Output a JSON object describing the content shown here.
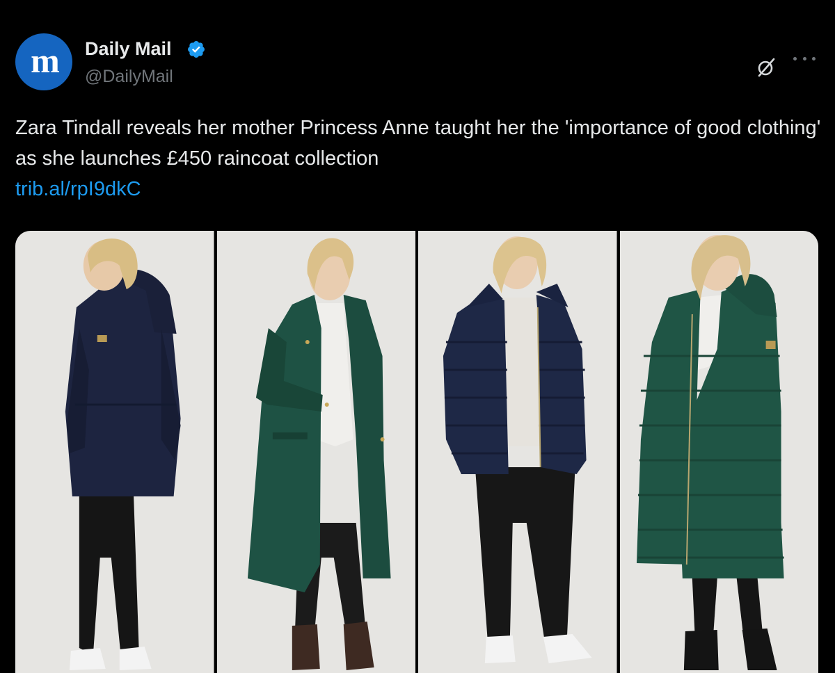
{
  "author": {
    "name": "Daily Mail",
    "handle": "@DailyMail",
    "avatar_letter": "m",
    "verified": true,
    "avatar_color": "#1565c0",
    "badge_color": "#1d9bf0"
  },
  "tweet": {
    "text": "Zara Tindall reveals her mother Princess Anne taught her the 'importance of good clothing' as she launches £450 raincoat collection",
    "link": "trib.al/rpI9dkC"
  },
  "icons": {
    "grok": "grok-icon",
    "more": "more-options-icon",
    "verified": "verified-badge-icon"
  },
  "media": {
    "photos": [
      {
        "coat": "navy hooded parka, back view",
        "coat_color": "#1d2440",
        "footwear": "white trainers"
      },
      {
        "coat": "long green coat",
        "coat_color": "#1e5244",
        "footwear": "brown ankle boots"
      },
      {
        "coat": "navy puffer jacket",
        "coat_color": "#1e2846",
        "footwear": "white trainers"
      },
      {
        "coat": "long green puffer coat",
        "coat_color": "#1f5545",
        "footwear": "black boots"
      }
    ]
  },
  "colors": {
    "background": "#000000",
    "text": "#e7e9ea",
    "secondary_text": "#71767b",
    "link": "#1d9bf0"
  }
}
